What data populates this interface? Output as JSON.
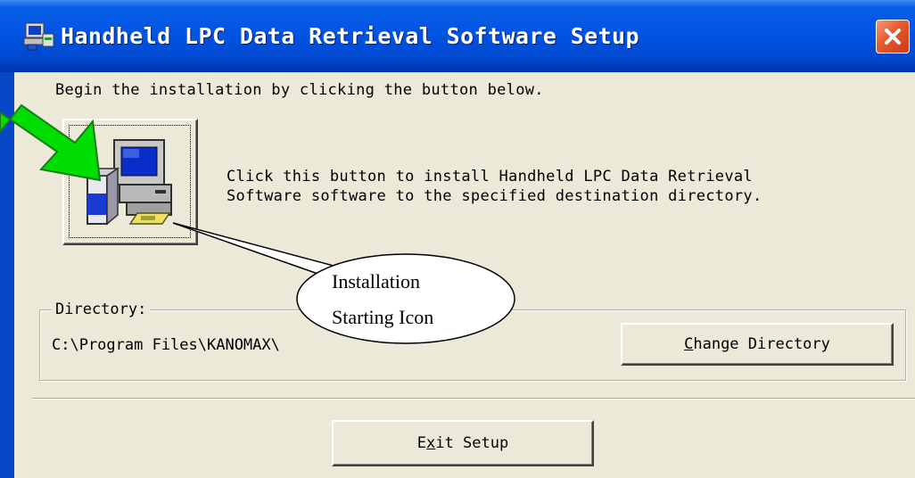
{
  "window": {
    "title": "Handheld LPC Data Retrieval Software Setup",
    "title_icon": "setup-icon",
    "close_icon": "close-icon"
  },
  "content": {
    "instruction": "Begin the installation by clicking the button below.",
    "install_button_icon": "computer-install-icon",
    "install_description_line1": "Click this button to install Handheld LPC Data Retrieval",
    "install_description_line2": "Software software to the specified destination directory."
  },
  "directory": {
    "label": "Directory:",
    "path": "C:\\Program Files\\KANOMAX\\",
    "change_button": {
      "mnemonic": "C",
      "rest": "hange Directory"
    }
  },
  "footer": {
    "exit_button": {
      "prefix": "E",
      "mnemonic": "x",
      "rest": "it Setup"
    }
  },
  "annotation": {
    "callout_line1": "Installation",
    "callout_line2": "Starting Icon",
    "arrow_icon": "green-arrow-icon",
    "colors": {
      "arrow_fill": "#00dd00",
      "arrow_stroke": "#1a7a1a"
    }
  },
  "colors": {
    "title_bar": "#0054e3",
    "dialog_face": "#ece9d8",
    "close_button": "#e35a2c"
  }
}
